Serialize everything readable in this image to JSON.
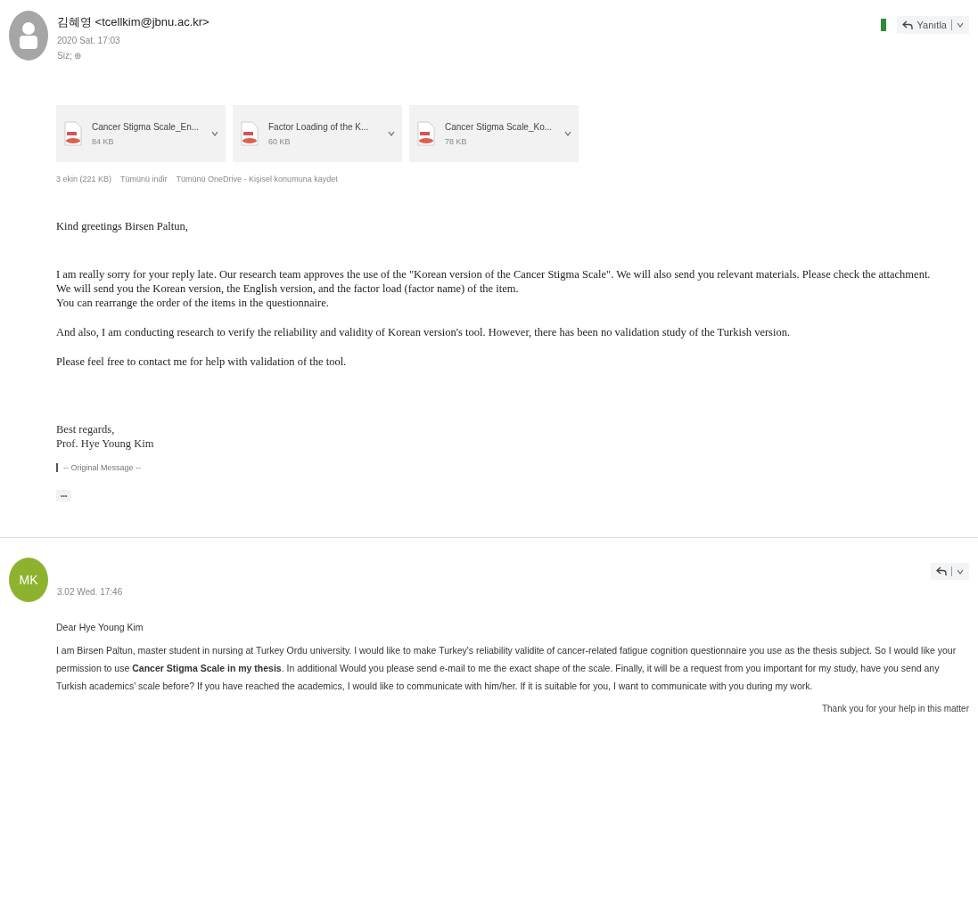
{
  "message": {
    "sender": "김혜영 <tcellkim@jbnu.ac.kr>",
    "date": "2020 Sat. 17:03",
    "to": "Siz; ⊕",
    "reply_label": "Yanıtla",
    "attachments": [
      {
        "name": "Cancer Stigma Scale_En...",
        "size": "84 KB"
      },
      {
        "name": "Factor Loading of the K...",
        "size": "60 KB"
      },
      {
        "name": "Cancer Stigma Scale_Ko...",
        "size": "78 KB"
      }
    ],
    "attachment_actions": [
      "3 ekin (221 KB)",
      "Tümünü indir",
      "Tümünü OneDrive - Kişisel konumuna kaydet"
    ],
    "body": [
      "Kind greetings Birsen Paltun,",
      "I am really sorry for your reply late. Our research team approves the use of the \"Korean version of the Cancer Stigma Scale\". We will also send you relevant materials. Please check the attachment.\nWe will send you the Korean version, the English version, and the factor load (factor name) of the item.\nYou can rearrange the order of the items in the questionnaire.",
      "And also, I am conducting research to verify the reliability and validity of Korean version's tool. However, there has been no validation study of the Turkish version.",
      "Please feel free to contact me for help with validation of the tool."
    ],
    "signature": "Best regards,\nProf. Hye Young Kim",
    "quote_label": "-- Original Message --",
    "expand_label": "•••"
  },
  "reply": {
    "avatar": "MK",
    "date": "3.02 Wed. 17:46",
    "body": [
      "Dear Hye Young Kim",
      "I am Birsen Paltun, master student in nursing at Turkey Ordu university. I would like to make Turkey's reliability validite of cancer-related fatigue cognition questionnaire you use as the thesis subject. So I would like your permission to use **Cancer Stigma Scale in my thesis**. In additional Would you please send e-mail to me the exact shape of the scale. Finally, it will be a request from you important for my study, have you send any Turkish academics' scale before? If you have reached the academics, I would like to communicate with him/her. If it is suitable for you, I want to communicate with you during my work."
    ],
    "closing": "Thank you for your help in this matter"
  }
}
